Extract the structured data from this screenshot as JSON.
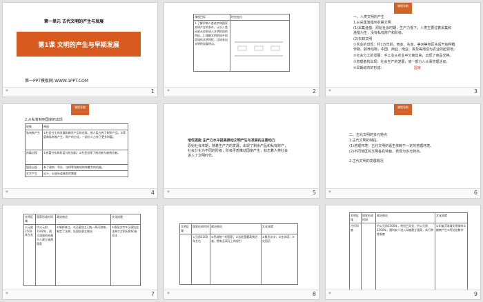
{
  "slide_numbers": [
    "1",
    "2",
    "3",
    "4",
    "5",
    "6",
    "7",
    "8",
    "9"
  ],
  "footer_mark": "*",
  "badge": "课程导航",
  "s1": {
    "unit": "第一单元  古代文明的产生与发展",
    "title": "第1课    文明的产生与早期发展",
    "site": "第一PPT模板网-WWW.1PPT.COM"
  },
  "s2": {
    "col1": "课程目标",
    "col2": "时空定位",
    "goals": "1.了解早期人类进步和国家文明产生的条件，认识人类历史从史前进入文明阶段的特征。2.理解文明阶段不同区域的文明特征，比较各自文明的发展特点。"
  },
  "s3": {
    "head": "一、人类文明的产生",
    "sub": "1.从采集渔猎到农耕文明",
    "p1": "(1)采集渔猎：原始社会时期，生产力低下，人类主要过着采集和",
    "p2": "渔猎为生，没有私有财产和阶级。",
    "p3": "(2)农耕文明",
    "p4": "①农业的出现：约1万年前，西亚、东亚、美洲等地区先后开始种植",
    "p5": "作物、驯养动物，中国、西亚、南亚、埃及等地成为农业的起源地。",
    "p6": "②社会分工的发展：手工业从农业中分离出来，出现了商品交换。",
    "p7": "③管理者的出现：社会生产的发展，使一部分人从事管理活动。",
    "p8": "④早期城市的形成：",
    "p8b": "国家"
  },
  "s4": {
    "head": "2.从私有制到国家的出现",
    "col1": "现象",
    "col2": "原因",
    "r1": "私有制产生",
    "r1b": "①社会分工的发展和剩余产品的出现，使人类占有了剩余产品。②家庭和私有制产生，财产的分化，一部分人占有了更多财富。",
    "r2": "阶级出现",
    "r2b": "①贫富分化和阶层分化加剧。②社会出现了统治者与被统治者。",
    "r3": "国家出现",
    "r3b": "有了政府、军队、法律等强制机构和暴力的机器。",
    "r4": "文字产生",
    "r4b": "出于、记录社会事务的需要"
  },
  "s5": {
    "head": "培优提能 生产力水平提高推动文明产生与发展的主要动力",
    "body1": "原始社会末期，随着生产力的发展，出现了剩余产品和私有财产，",
    "body2": "社会分化为不同的阶级，阶级矛盾推动国家产生，标志着人类社会",
    "body3": "进入了文明时代。"
  },
  "s6": {
    "head": "二、古代文明的多元特点",
    "p1": "1.古代文明的特征",
    "p2": "(1)地理环境：古代文明的诞生依赖于一定的地理环境。",
    "p3": "(2)不同地区的文明各具特色，表现为多元特点。",
    "p4": "2.古代文明的发展概况"
  },
  "s7": {
    "c1": "文明区域",
    "c2": "国家形成时间",
    "c3": "政治统治",
    "c4": "文化成就",
    "row1": "公元前3500年左右",
    "row1b": "约公元前3500年，两河流域的苏美尔人建立城邦国家",
    "row1c": "①城邦林立，②汉谟拉比王统一两河流域，制定了法典，巩固奴隶主统治",
    "row1d": "①楔形文字②汉谟拉比法典③太阴历和60进位法"
  },
  "s8": {
    "c1": "文明区域",
    "c2": "国家形成时间",
    "c3": "政治统治",
    "c4": "文化成就",
    "row1": "公元前3100年左右",
    "row1b": "①形成统一的国家；②法老是最高统治者，拥有至高无上的权力",
    "row1c": "①象形文字；②金字塔；③太阳历"
  },
  "s9": {
    "c1": "文明区域",
    "c2": "国家形成时间",
    "c3": "政治统治",
    "c4": "文化成就",
    "row1": "古代印度",
    "row1b": "约公元前2500年，哈拉巴文化；约公元前1500年，雅利安人进入印度建立国家，实行种姓制度",
    "row1c": "①印度河流域文明城市②佛教产生③阿拉伯数字"
  }
}
